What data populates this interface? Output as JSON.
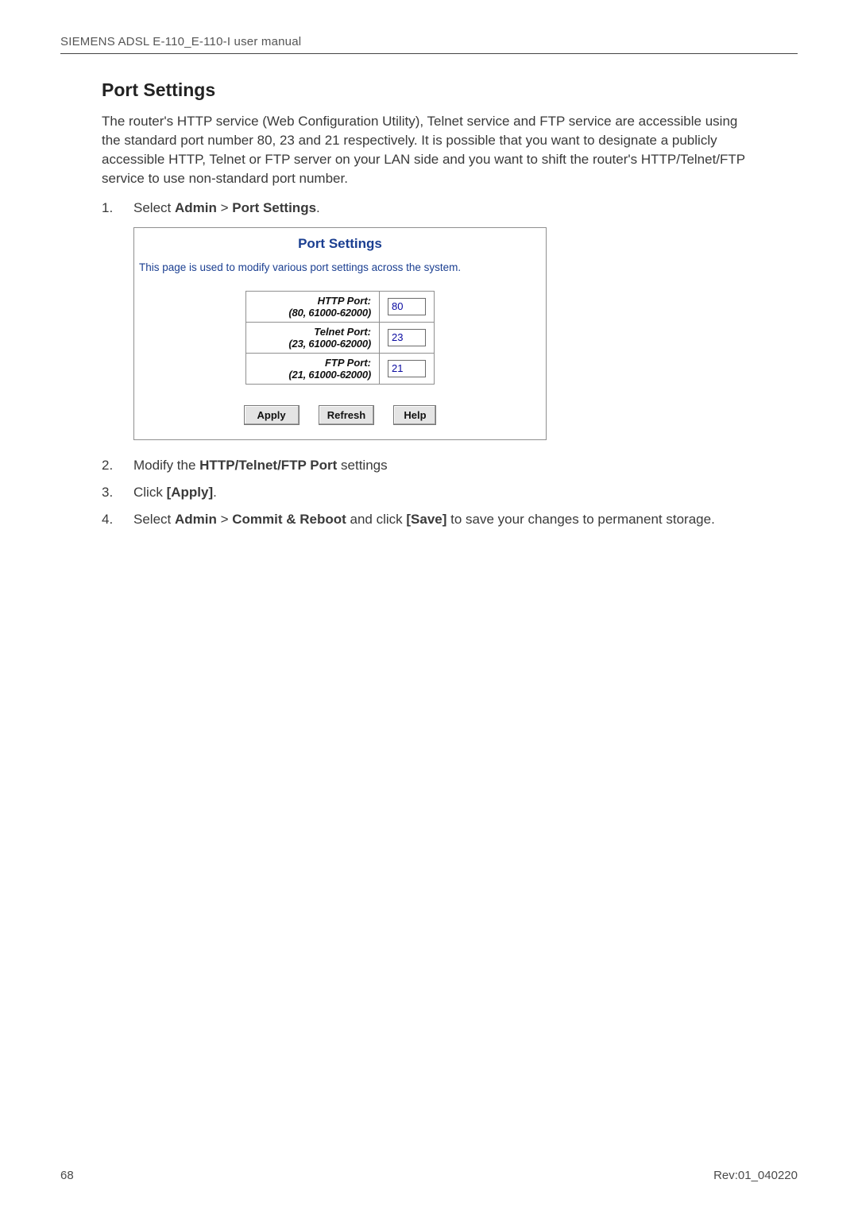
{
  "header": {
    "doc_title": "SIEMENS ADSL E-110_E-110-I user manual"
  },
  "section": {
    "title": "Port Settings",
    "paragraph": "The router's HTTP service (Web Configuration Utility), Telnet service and FTP service are accessible using the standard port number 80, 23 and 21 respectively. It is possible that you want to designate a publicly accessible HTTP, Telnet or FTP server on your LAN side and you want to shift the router's HTTP/Telnet/FTP service to use non-standard port number."
  },
  "steps": {
    "one": {
      "num": "1.",
      "prefix": "Select ",
      "bold": "Admin",
      "sep": " > ",
      "bold2": "Port Settings",
      "suffix": "."
    },
    "two": {
      "num": "2.",
      "prefix": "Modify the ",
      "bold": "HTTP/Telnet/FTP Port",
      "suffix": " settings"
    },
    "three": {
      "num": "3.",
      "prefix": "Click ",
      "bold": "[Apply]",
      "suffix": "."
    },
    "four": {
      "num": "4.",
      "prefix": "Select ",
      "bold": "Admin",
      "sep": " > ",
      "bold2": "Commit & Reboot",
      "mid": " and click ",
      "bold3": "[Save]",
      "suffix": " to save your changes to permanent storage."
    }
  },
  "panel": {
    "title": "Port Settings",
    "desc": "This page is used to modify various port settings across the system.",
    "rows": {
      "http": {
        "label": "HTTP Port:",
        "range": "(80, 61000-62000)",
        "value": "80"
      },
      "telnet": {
        "label": "Telnet Port:",
        "range": "(23, 61000-62000)",
        "value": "23"
      },
      "ftp": {
        "label": "FTP Port:",
        "range": "(21, 61000-62000)",
        "value": "21"
      }
    },
    "buttons": {
      "apply": "Apply",
      "refresh": "Refresh",
      "help": "Help"
    }
  },
  "footer": {
    "page": "68",
    "rev": "Rev:01_040220"
  }
}
